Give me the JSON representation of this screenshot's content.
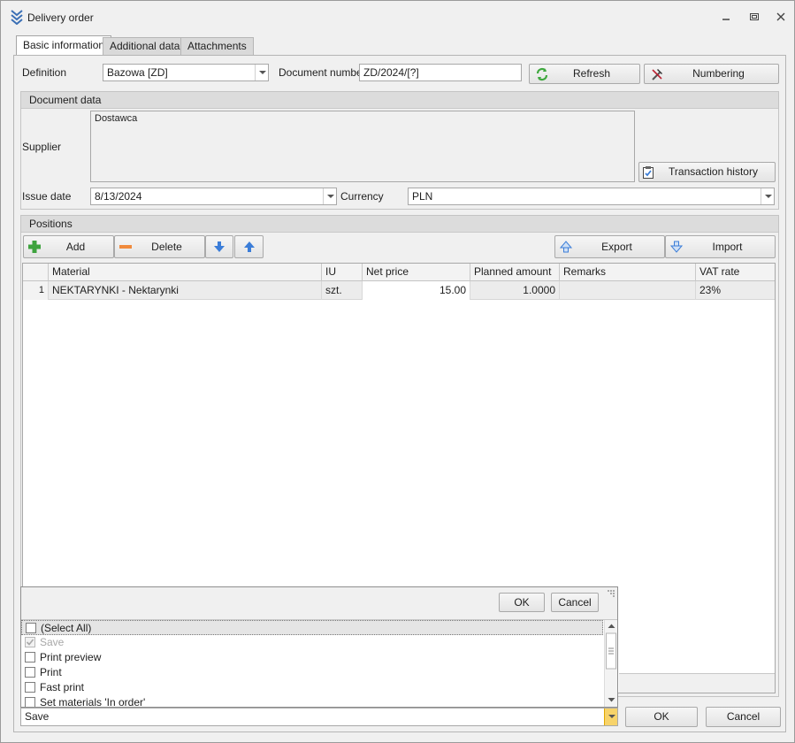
{
  "window": {
    "title": "Delivery order",
    "icon": "chevrons-down-icon"
  },
  "tabs": [
    {
      "label": "Basic information",
      "active": true
    },
    {
      "label": "Additional data",
      "active": false
    },
    {
      "label": "Attachments",
      "active": false
    }
  ],
  "header": {
    "definition_label": "Definition",
    "definition_value": "Bazowa [ZD]",
    "docnum_label": "Document number",
    "docnum_value": "ZD/2024/[?]",
    "refresh_label": "Refresh",
    "numbering_label": "Numbering"
  },
  "document_data": {
    "group_title": "Document data",
    "supplier_label": "Supplier",
    "supplier_value": "Dostawca",
    "transaction_history_label": "Transaction history",
    "issue_date_label": "Issue date",
    "issue_date_value": "8/13/2024",
    "currency_label": "Currency",
    "currency_value": "PLN"
  },
  "positions": {
    "group_title": "Positions",
    "add_label": "Add",
    "delete_label": "Delete",
    "export_label": "Export",
    "import_label": "Import",
    "columns": [
      "Material",
      "IU",
      "Net price",
      "Planned amount",
      "Remarks",
      "VAT rate"
    ],
    "rows": [
      {
        "index": "1",
        "material": "NEKTARYNKI - Nektarynki",
        "iu": "szt.",
        "net_price": "15.00",
        "planned_amount": "1.0000",
        "remarks": "",
        "vat_rate": "23%"
      }
    ]
  },
  "dropdown": {
    "ok_label": "OK",
    "cancel_label": "Cancel",
    "items": [
      {
        "label": "(Select All)",
        "checked": false,
        "disabled": false
      },
      {
        "label": "Save",
        "checked": true,
        "disabled": true
      },
      {
        "label": "Print preview",
        "checked": false,
        "disabled": false
      },
      {
        "label": "Print",
        "checked": false,
        "disabled": false
      },
      {
        "label": "Fast print",
        "checked": false,
        "disabled": false
      },
      {
        "label": "Set materials 'In order'",
        "checked": false,
        "disabled": false
      }
    ]
  },
  "footer": {
    "action_value": "Save",
    "ok_label": "OK",
    "cancel_label": "Cancel"
  },
  "colors": {
    "accent_blue": "#3b7dd8",
    "add_green": "#3ea33e",
    "delete_orange": "#f08a3c",
    "refresh_green": "#3fa83f"
  }
}
